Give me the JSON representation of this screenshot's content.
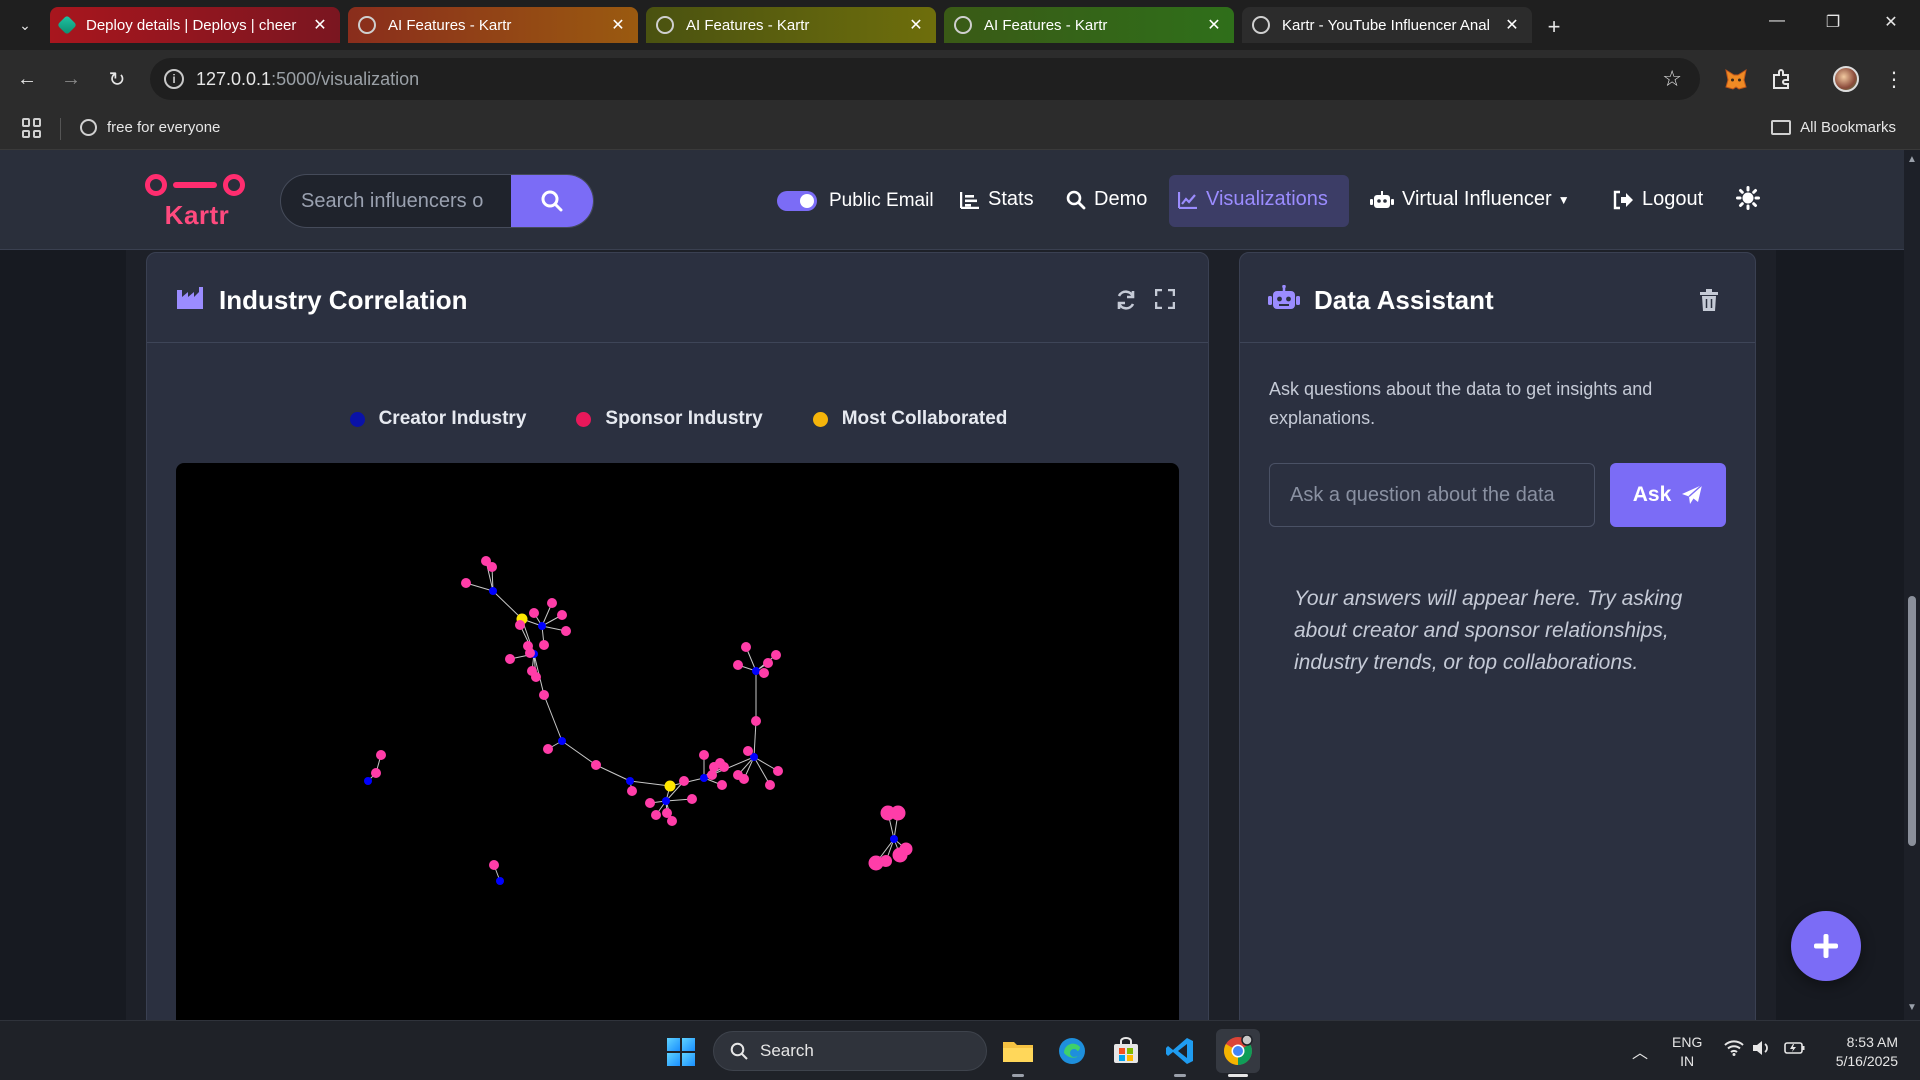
{
  "browser": {
    "tabs": [
      {
        "title": "Deploy details | Deploys | cheer"
      },
      {
        "title": "AI Features - Kartr"
      },
      {
        "title": "AI Features - Kartr"
      },
      {
        "title": "AI Features - Kartr"
      },
      {
        "title": "Kartr - YouTube Influencer Anal"
      }
    ],
    "url_host": "127.0.0.1",
    "url_path": ":5000/visualization",
    "bookmarks": {
      "item": "free for everyone",
      "all": "All Bookmarks"
    }
  },
  "navbar": {
    "logo": "Kartr",
    "search_placeholder": "Search influencers o",
    "public_email": "Public Email",
    "stats": "Stats",
    "demo": "Demo",
    "visualizations": "Visualizations",
    "virtual_influencer": "Virtual Influencer",
    "logout": "Logout"
  },
  "viz": {
    "title": "Industry Correlation",
    "legend": [
      {
        "label": "Creator Industry",
        "color": "#0a12a8"
      },
      {
        "label": "Sponsor Industry",
        "color": "#e8185a"
      },
      {
        "label": "Most Collaborated",
        "color": "#f5b40a"
      }
    ]
  },
  "assistant": {
    "title": "Data Assistant",
    "description": "Ask questions about the data to get insights and explanations.",
    "input_placeholder": "Ask a question about the data",
    "ask_label": "Ask",
    "answer_hint": "Your answers will appear here. Try asking about creator and sponsor relationships, industry trends, or top collaborations."
  },
  "taskbar": {
    "search": "Search",
    "lang_top": "ENG",
    "lang_bottom": "IN",
    "time": "8:53 AM",
    "date": "5/16/2025"
  },
  "colors": {
    "accent": "#7b6cf6",
    "brand": "#ff2d6f",
    "creator": "#0000ff",
    "sponsor": "#ff3da8",
    "collab": "#ffe600"
  }
}
